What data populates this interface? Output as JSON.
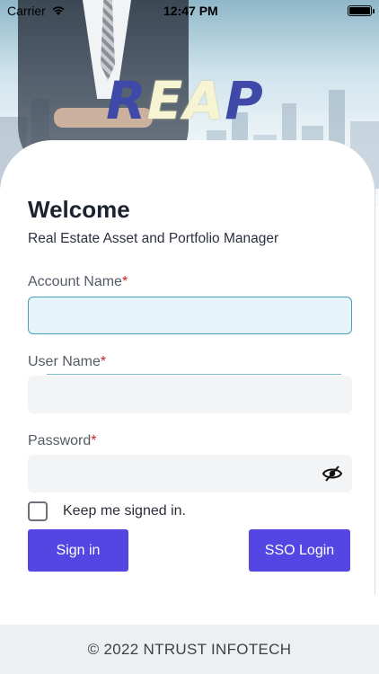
{
  "status_bar": {
    "carrier": "Carrier",
    "time": "12:47 PM"
  },
  "hero": {
    "logo_text_left": "R",
    "logo_text_accent": "EA",
    "logo_text_right": "P"
  },
  "welcome": {
    "title": "Welcome",
    "subtitle": "Real Estate Asset and Portfolio Manager"
  },
  "form": {
    "account_name_label": "Account Name",
    "account_name_value": "",
    "user_name_label": "User Name",
    "user_name_value": "",
    "password_label": "Password",
    "password_value": "",
    "required_marker": "*",
    "keep_signed_in_label": "Keep me signed in.",
    "keep_signed_in_checked": false
  },
  "buttons": {
    "sign_in": "Sign in",
    "sso_login": "SSO Login"
  },
  "footer": {
    "copyright": "© 2022 NTRUST INFOTECH"
  },
  "colors": {
    "primary_button": "#5446e3",
    "required": "#d32020",
    "focus_border": "#4aa0bc"
  }
}
